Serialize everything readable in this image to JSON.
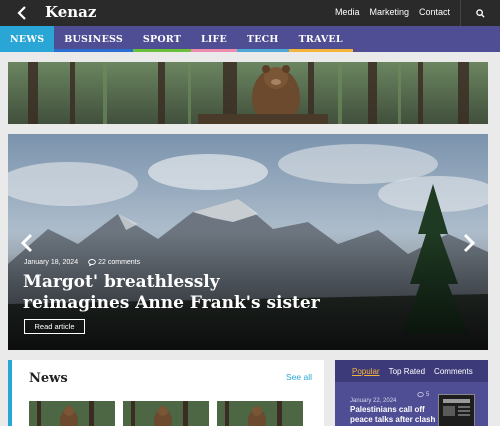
{
  "header": {
    "logo": "Kenaz",
    "links": [
      "Media",
      "Marketing",
      "Contact"
    ]
  },
  "nav": {
    "categories": [
      {
        "label": "NEWS",
        "color": "#2aa6d6"
      },
      {
        "label": "BUSINESS",
        "color": "#2b6fd1"
      },
      {
        "label": "SPORT",
        "color": "#6cbf3a"
      },
      {
        "label": "LIFE",
        "color": "#f08bb0"
      },
      {
        "label": "TECH",
        "color": "#4da9d8"
      },
      {
        "label": "TRAVEL",
        "color": "#f4b33a"
      }
    ],
    "active_index": 0
  },
  "hero": {
    "date": "January 18, 2024",
    "comments": "22 comments",
    "title": "Margot' breathlessly reimagines Anne Frank's sister",
    "button": "Read article"
  },
  "news": {
    "title": "News",
    "see_all": "See all"
  },
  "sidebar": {
    "tabs": [
      "Popular",
      "Top Rated",
      "Comments"
    ],
    "active_tab": 0,
    "item": {
      "date": "January 22, 2024",
      "count": "5",
      "headline": "Palestinians call off peace talks after clash"
    }
  },
  "colors": {
    "topbar": "#2a2a2a",
    "nav": "#4f4d93",
    "accent": "#2aa6d6",
    "highlight": "#f3b43a"
  }
}
